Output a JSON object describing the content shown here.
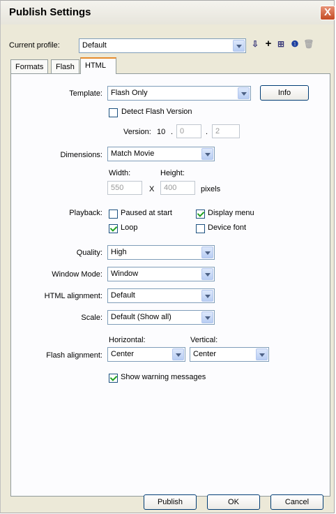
{
  "window": {
    "title": "Publish Settings",
    "close_symbol": "X"
  },
  "profile": {
    "label": "Current profile:",
    "value": "Default"
  },
  "tabs": [
    {
      "label": "Formats"
    },
    {
      "label": "Flash"
    },
    {
      "label": "HTML"
    }
  ],
  "template": {
    "label": "Template:",
    "value": "Flash Only",
    "info_button": "Info",
    "detect_label": "Detect Flash Version",
    "detect_checked": false,
    "version_label": "Version:",
    "version_major": "10",
    "version_dot1": ".",
    "version_minor": "0",
    "version_dot2": ".",
    "version_revision": "2"
  },
  "dimensions": {
    "label": "Dimensions:",
    "value": "Match Movie",
    "width_label": "Width:",
    "height_label": "Height:",
    "width_value": "550",
    "times": "X",
    "height_value": "400",
    "unit": "pixels"
  },
  "playback": {
    "label": "Playback:",
    "paused_label": "Paused at start",
    "paused_checked": false,
    "display_menu_label": "Display menu",
    "display_menu_checked": true,
    "loop_label": "Loop",
    "loop_checked": true,
    "device_font_label": "Device font",
    "device_font_checked": false
  },
  "quality": {
    "label": "Quality:",
    "value": "High"
  },
  "window_mode": {
    "label": "Window Mode:",
    "value": "Window"
  },
  "html_alignment": {
    "label": "HTML alignment:",
    "value": "Default"
  },
  "scale": {
    "label": "Scale:",
    "value": "Default (Show all)"
  },
  "flash_alignment": {
    "label": "Flash alignment:",
    "horizontal_label": "Horizontal:",
    "vertical_label": "Vertical:",
    "horizontal_value": "Center",
    "vertical_value": "Center"
  },
  "warnings": {
    "label": "Show warning messages",
    "checked": true
  },
  "buttons": {
    "publish": "Publish",
    "ok": "OK",
    "cancel": "Cancel"
  }
}
